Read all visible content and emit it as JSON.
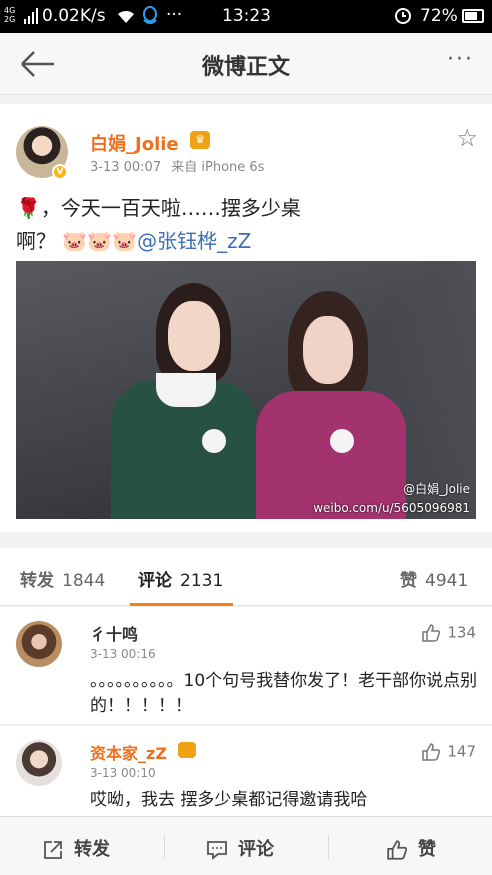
{
  "status_bar": {
    "network_top": "4G",
    "network_bottom": "2G",
    "speed": "0.02K/s",
    "time": "13:23",
    "battery": "72%",
    "battery_level": 0.72,
    "icons": [
      "signal-icon",
      "wifi-icon",
      "qq-icon",
      "alarm-icon",
      "battery-icon"
    ]
  },
  "nav": {
    "title": "微博正文",
    "more": "···"
  },
  "post": {
    "author": "白娟_Jolie",
    "date": "3-13 00:07",
    "source": "来自 iPhone 6s",
    "text_line1": "，今天一百天啦……摆多少桌",
    "text_line2": "啊？",
    "emoji_rose": "🌹",
    "emoji_pigs": "🐷🐷🐷",
    "mention": "@张钰桦_zZ",
    "watermark_user": "@白娟_Jolie",
    "watermark_url": "weibo.com/u/5605096981"
  },
  "tabs": [
    {
      "label": "转发",
      "count": "1844"
    },
    {
      "label": "评论",
      "count": "2131"
    },
    {
      "label": "赞",
      "count": "4941"
    }
  ],
  "comments": [
    {
      "name": "彳十鸣",
      "time": "3-13 00:16",
      "text": "。。。。。。。。。。10个句号我替你发了！老干部你说点别的！！！！！",
      "likes": "134"
    },
    {
      "name": "资本家_zZ",
      "time": "3-13 00:10",
      "text": "哎呦，我去 摆多少桌都记得邀请我哈",
      "likes": "147"
    }
  ],
  "toolbar": {
    "repost": "转发",
    "comment": "评论",
    "like": "赞"
  },
  "colors": {
    "accent": "#f57f17",
    "username": "#f06f1c",
    "mention": "#3b6fb6"
  }
}
